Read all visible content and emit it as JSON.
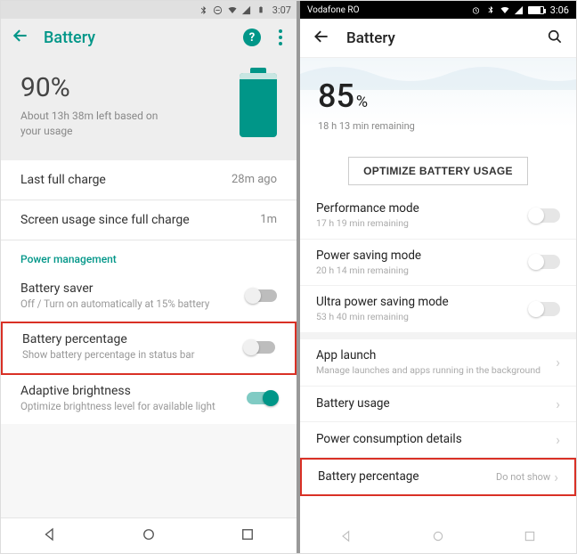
{
  "left": {
    "status": {
      "time": "3:07"
    },
    "header": {
      "title": "Battery"
    },
    "hero": {
      "percent": "90%",
      "subtitle": "About 13h 38m left based on your usage"
    },
    "stats": {
      "last_charge_label": "Last full charge",
      "last_charge_value": "28m ago",
      "screen_usage_label": "Screen usage since full charge",
      "screen_usage_value": "1m"
    },
    "pm_title": "Power management",
    "saver": {
      "label": "Battery saver",
      "desc": "Off / Turn on automatically at 15% battery"
    },
    "pct_row": {
      "label": "Battery percentage",
      "desc": "Show battery percentage in status bar"
    },
    "adaptive": {
      "label": "Adaptive brightness",
      "desc": "Optimize brightness level for available light"
    }
  },
  "right": {
    "status": {
      "carrier": "Vodafone RO",
      "time": "3:06"
    },
    "header": {
      "title": "Battery"
    },
    "hero": {
      "percent": "85",
      "mark": "%",
      "subtitle": "18 h 13 min remaining"
    },
    "optimize_label": "OPTIMIZE BATTERY USAGE",
    "perf": {
      "label": "Performance mode",
      "desc": "17 h 19 min remaining"
    },
    "psave": {
      "label": "Power saving mode",
      "desc": "20 h 14 min remaining"
    },
    "ultra": {
      "label": "Ultra power saving mode",
      "desc": "53 h 40 min remaining"
    },
    "app_launch": {
      "label": "App launch",
      "desc": "Manage launches and apps running in the background"
    },
    "batt_usage": {
      "label": "Battery usage"
    },
    "consumption": {
      "label": "Power consumption details"
    },
    "batt_pct": {
      "label": "Battery percentage",
      "value": "Do not show"
    }
  }
}
